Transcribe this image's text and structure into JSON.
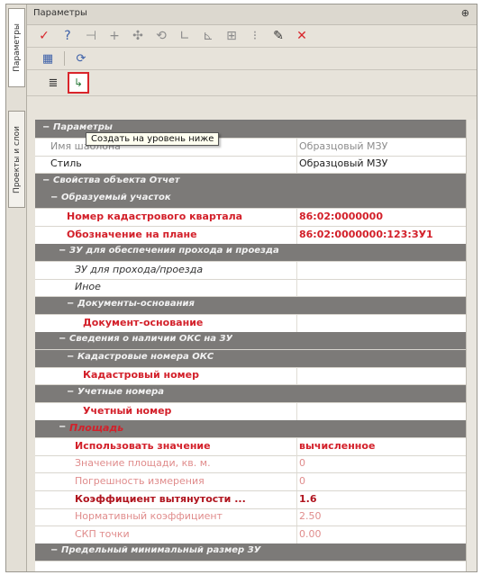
{
  "vertical_tabs": [
    "Параметры",
    "Проекты и слои"
  ],
  "window": {
    "title": "Параметры",
    "pin": "⊕"
  },
  "toolbar1": {
    "icons": [
      {
        "name": "checkmark-icon",
        "glyph": "✓",
        "color": "red"
      },
      {
        "name": "help-icon",
        "glyph": "?",
        "color": "blue"
      },
      {
        "name": "split-icon",
        "glyph": "⊣",
        "color": "gray"
      },
      {
        "name": "plus-icon",
        "glyph": "+",
        "color": "gray"
      },
      {
        "name": "move-icon",
        "glyph": "✣",
        "color": "gray"
      },
      {
        "name": "rotate-icon",
        "glyph": "⟲",
        "color": "gray"
      },
      {
        "name": "angle-icon",
        "glyph": "∟",
        "color": "gray"
      },
      {
        "name": "measure-icon",
        "glyph": "⊾",
        "color": "gray"
      },
      {
        "name": "grid-icon",
        "glyph": "⊞",
        "color": "gray"
      },
      {
        "name": "dots-icon",
        "glyph": "⁝",
        "color": "gray"
      },
      {
        "name": "pipette-icon",
        "glyph": "✎",
        "color": "dark"
      },
      {
        "name": "close-icon",
        "glyph": "✕",
        "color": "red"
      }
    ]
  },
  "tooltip": "Создать на уровень ниже",
  "rows": [
    {
      "type": "group",
      "indent": 0,
      "text": "Параметры",
      "toggle": "−"
    },
    {
      "type": "prop",
      "indent": 1,
      "text": "Имя шаблона",
      "value": "Образцовый МЗУ",
      "style": "gray"
    },
    {
      "type": "prop",
      "indent": 1,
      "text": "Стиль",
      "value": "Образцовый МЗУ",
      "style": "normal"
    },
    {
      "type": "group",
      "indent": 0,
      "text": "Свойства объекта Отчет",
      "toggle": "−"
    },
    {
      "type": "group",
      "indent": 1,
      "text": "Образуемый участок",
      "toggle": "−"
    },
    {
      "type": "prop",
      "indent": 3,
      "text": "Номер кадастрового квартала",
      "value": "86:02:0000000",
      "style": "req"
    },
    {
      "type": "prop",
      "indent": 3,
      "text": "Обозначение на плане",
      "value": "86:02:0000000:123:ЗУ1",
      "style": "req"
    },
    {
      "type": "group",
      "indent": 2,
      "text": "ЗУ для обеспечения прохода и проезда",
      "toggle": "−"
    },
    {
      "type": "prop",
      "indent": 4,
      "text": "ЗУ для прохода/проезда",
      "value": "",
      "style": "ital"
    },
    {
      "type": "prop",
      "indent": 4,
      "text": "Иное",
      "value": "",
      "style": "ital"
    },
    {
      "type": "group",
      "indent": 3,
      "text": "Документы-основания",
      "toggle": "−"
    },
    {
      "type": "prop",
      "indent": 5,
      "text": "Документ-основание",
      "value": "",
      "style": "req"
    },
    {
      "type": "group",
      "indent": 2,
      "text": "Сведения о наличии ОКС на ЗУ",
      "toggle": "−"
    },
    {
      "type": "group",
      "indent": 3,
      "text": "Кадастровые номера ОКС",
      "toggle": "−"
    },
    {
      "type": "prop",
      "indent": 5,
      "text": "Кадастровый номер",
      "value": "",
      "style": "req"
    },
    {
      "type": "group",
      "indent": 3,
      "text": "Учетные номера",
      "toggle": "−"
    },
    {
      "type": "prop",
      "indent": 5,
      "text": "Учетный номер",
      "value": "",
      "style": "req"
    },
    {
      "type": "group",
      "indent": 2,
      "text": "Площадь",
      "toggle": "−",
      "highlight": true
    },
    {
      "type": "prop",
      "indent": 4,
      "text": "Использовать значение",
      "value": "вычисленное",
      "style": "req"
    },
    {
      "type": "prop",
      "indent": 4,
      "text": "Значение площади, кв. м.",
      "value": "0",
      "style": "faint"
    },
    {
      "type": "prop",
      "indent": 4,
      "text": "Погрешность измерения",
      "value": "0",
      "style": "faint"
    },
    {
      "type": "prop",
      "indent": 4,
      "text": "Коэффициент вытянутости ...",
      "value": "1.6",
      "style": "reqdark"
    },
    {
      "type": "prop",
      "indent": 4,
      "text": "Нормативный коэффициент",
      "value": "2.50",
      "style": "faint"
    },
    {
      "type": "prop",
      "indent": 4,
      "text": "СКП точки",
      "value": "0.00",
      "style": "faint"
    },
    {
      "type": "group",
      "indent": 1,
      "text": "Предельный минимальный размер ЗУ",
      "toggle": "−"
    }
  ]
}
